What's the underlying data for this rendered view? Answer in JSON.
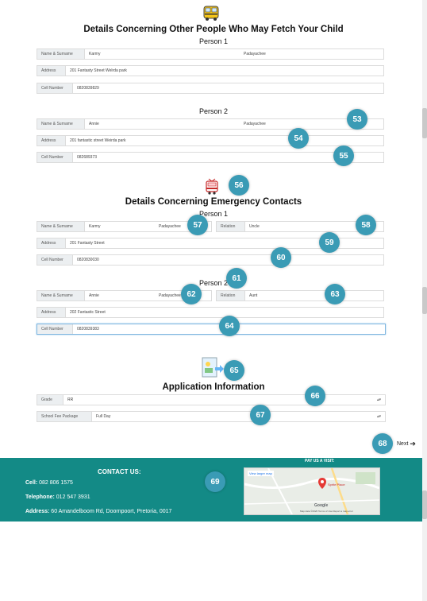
{
  "section_other": {
    "title": "Details Concerning Other People Who May Fetch Your Child",
    "people": [
      {
        "heading": "Person 1",
        "name_label": "Name & Surname",
        "name": "Karmy",
        "surname": "Padayachee",
        "address_label": "Address",
        "address": "201 Fantasty Street Welrda park",
        "cell_label": "Cell Number",
        "cell": "0820839829"
      },
      {
        "heading": "Person 2",
        "name_label": "Name & Surname",
        "name": "Annie",
        "surname": "Padayachee",
        "address_label": "Address",
        "address": "201 fantastic street Weirda park",
        "cell_label": "Cell Number",
        "cell": "082689373"
      }
    ]
  },
  "section_emergency": {
    "title": "Details Concerning Emergency Contacts",
    "people": [
      {
        "heading": "Person 1",
        "name_label": "Name & Surname",
        "name": "Karmy",
        "surname": "Padayachee",
        "relation_label": "Relation",
        "relation": "Uncle",
        "address_label": "Address",
        "address": "201 Fantasty Street",
        "cell_label": "Cell Number",
        "cell": "0820830030"
      },
      {
        "heading": "Person 2",
        "name_label": "Name & Surname",
        "name": "Annie",
        "surname": "Padayachee",
        "relation_label": "Relation",
        "relation": "Aunt",
        "address_label": "Address",
        "address": "202 Fantastic Street",
        "cell_label": "Cell Number",
        "cell": "0820839383"
      }
    ]
  },
  "section_application": {
    "title": "Application Information",
    "grade_label": "Grade",
    "grade": "RR",
    "package_label": "School Fee Package",
    "package": "Full Day"
  },
  "next_label": "Next",
  "badges": [
    "53",
    "54",
    "55",
    "56",
    "57",
    "58",
    "59",
    "60",
    "61",
    "62",
    "63",
    "64",
    "65",
    "66",
    "67",
    "68",
    "69"
  ],
  "footer": {
    "contact_heading": "CONTACT US:",
    "cell_label": "Cell:",
    "cell": "082 806 1575",
    "telephone_label": "Telephone:",
    "telephone": "012 547 3931",
    "address_label": "Address:",
    "address": "60 Amandelboom Rd, Doornpoort, Pretoria, 0017",
    "visit_heading": "PAY US A VISIT:",
    "map_larger": "View larger map",
    "map_place": "Sprite Place",
    "map_brand": "Google",
    "map_footer": "Map data ©2020  Terms of Use  Report a map error"
  },
  "colors": {
    "footer": "#138a86",
    "badge": "#3a9bb5",
    "map_pin": "#e53935"
  },
  "icons": [
    "bus-icon",
    "tram-icon",
    "document-arrow-icon",
    "arrow-right-icon",
    "map-pin-icon"
  ]
}
